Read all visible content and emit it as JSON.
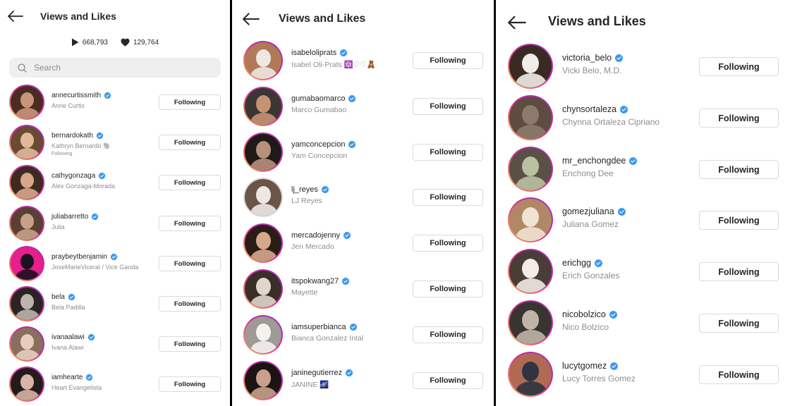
{
  "colors": {
    "verified": "#3897f0",
    "ring_start": "#f4b84a",
    "ring_mid": "#d6249f",
    "ring_end": "#8a3ab9",
    "muted": "#8e8e8e",
    "border": "#dbdbdb"
  },
  "panels": [
    {
      "title": "Views and Likes",
      "stats": {
        "views": "668,793",
        "likes": "129,764"
      },
      "search": {
        "placeholder": "Search"
      },
      "users": [
        {
          "username": "annecurtissmith",
          "fullname": "Anne Curtis",
          "button": "Following"
        },
        {
          "username": "bernardokath",
          "fullname": "Kathryn Bernardo 🐘",
          "sub": "Following",
          "button": "Following"
        },
        {
          "username": "cathygonzaga",
          "fullname": "Alex Gonzaga-Morada",
          "button": "Following"
        },
        {
          "username": "juliabarretto",
          "fullname": "Julia",
          "button": "Following"
        },
        {
          "username": "praybeytbenjamin",
          "fullname": "JoseMarieViceral / Vice Ganda",
          "button": "Following"
        },
        {
          "username": "bela",
          "fullname": "Bela Padilla",
          "button": "Following"
        },
        {
          "username": "ivanaalawi",
          "fullname": "Ivana Alawi",
          "button": "Following"
        },
        {
          "username": "iamhearte",
          "fullname": "Heart Evangelista",
          "button": "Following"
        }
      ]
    },
    {
      "title": "Views and Likes",
      "users": [
        {
          "username": "isabeloliprats",
          "fullname": "Isabel Oli-Prats 🔯♡♡🧸",
          "button": "Following"
        },
        {
          "username": "gumabaomarco",
          "fullname": "Marco Gumabao",
          "button": "Following"
        },
        {
          "username": "yamconcepcion",
          "fullname": "Yam Concepcion",
          "button": "Following"
        },
        {
          "username": "lj_reyes",
          "fullname": "LJ Reyes",
          "button": "Following"
        },
        {
          "username": "mercadojenny",
          "fullname": "Jen Mercado",
          "button": "Following"
        },
        {
          "username": "itspokwang27",
          "fullname": "Mayette",
          "button": "Following"
        },
        {
          "username": "iamsuperbianca",
          "fullname": "Bianca Gonzalez Intal",
          "button": "Following"
        },
        {
          "username": "janinegutierrez",
          "fullname": "JANINE 🌌",
          "button": "Following"
        }
      ]
    },
    {
      "title": "Views and Likes",
      "users": [
        {
          "username": "victoria_belo",
          "fullname": "Vicki Belo, M.D.",
          "button": "Following"
        },
        {
          "username": "chynsortaleza",
          "fullname": "Chynna Ortaleza Cipriano",
          "button": "Following"
        },
        {
          "username": "mr_enchongdee",
          "fullname": "Enchong Dee",
          "button": "Following"
        },
        {
          "username": "gomezjuliana",
          "fullname": "Juliana Gomez",
          "button": "Following"
        },
        {
          "username": "erichgg",
          "fullname": "Erich Gonzales",
          "button": "Following"
        },
        {
          "username": "nicobolzico",
          "fullname": "Nico Bolzico",
          "button": "Following"
        },
        {
          "username": "lucytgomez",
          "fullname": "Lucy Torres Gomez",
          "button": "Following"
        }
      ]
    }
  ]
}
